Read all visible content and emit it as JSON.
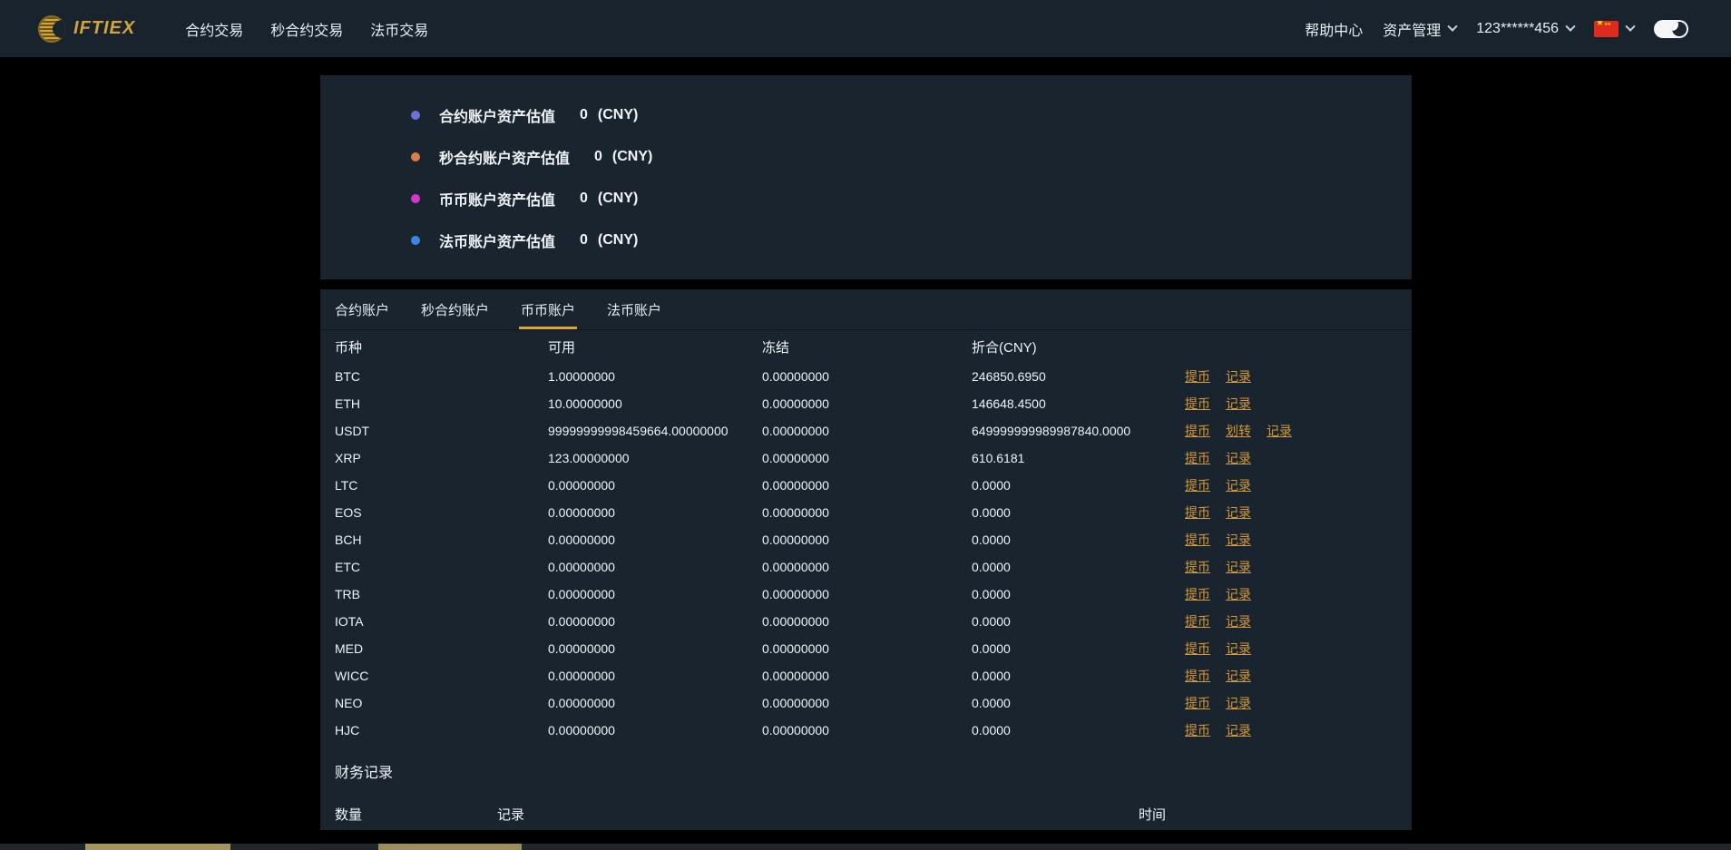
{
  "colors": {
    "page_bg": "#000000",
    "navbar_bg": "#19232d",
    "panel_bg": "#1a242f",
    "accent_gold_link": "#d29a39",
    "tab_underline": "#d9a740",
    "flag_red": "#de2b1e"
  },
  "navbar": {
    "logo_text": "IFTIEX",
    "items": [
      {
        "label": "合约交易"
      },
      {
        "label": "秒合约交易"
      },
      {
        "label": "法币交易"
      }
    ],
    "help": "帮助中心",
    "assets_menu": "资产管理",
    "account": "123******456"
  },
  "summary": {
    "rows": [
      {
        "label": "合约账户资产估值",
        "value": "0",
        "unit": "(CNY)",
        "color": "#7070dd"
      },
      {
        "label": "秒合约账户资产估值",
        "value": "0",
        "unit": "(CNY)",
        "color": "#e07b4a"
      },
      {
        "label": "币币账户资产估值",
        "value": "0",
        "unit": "(CNY)",
        "color": "#d238ce"
      },
      {
        "label": "法币账户资产估值",
        "value": "0",
        "unit": "(CNY)",
        "color": "#3a87e6"
      }
    ]
  },
  "tabs": [
    {
      "label": "合约账户",
      "active": false
    },
    {
      "label": "秒合约账户",
      "active": false
    },
    {
      "label": "币币账户",
      "active": true
    },
    {
      "label": "法币账户",
      "active": false
    }
  ],
  "wallet": {
    "headers": {
      "coin": "币种",
      "available": "可用",
      "frozen": "冻结",
      "cny": "折合(CNY)"
    },
    "action_labels": {
      "withdraw": "提币",
      "transfer": "划转",
      "record": "记录"
    },
    "rows": [
      {
        "coin": "BTC",
        "available": "1.00000000",
        "frozen": "0.00000000",
        "cny": "246850.6950"
      },
      {
        "coin": "ETH",
        "available": "10.00000000",
        "frozen": "0.00000000",
        "cny": "146648.4500"
      },
      {
        "coin": "USDT",
        "available": "99999999998459664.00000000",
        "frozen": "0.00000000",
        "cny": "649999999989987840.0000",
        "has_transfer": true
      },
      {
        "coin": "XRP",
        "available": "123.00000000",
        "frozen": "0.00000000",
        "cny": "610.6181"
      },
      {
        "coin": "LTC",
        "available": "0.00000000",
        "frozen": "0.00000000",
        "cny": "0.0000"
      },
      {
        "coin": "EOS",
        "available": "0.00000000",
        "frozen": "0.00000000",
        "cny": "0.0000"
      },
      {
        "coin": "BCH",
        "available": "0.00000000",
        "frozen": "0.00000000",
        "cny": "0.0000"
      },
      {
        "coin": "ETC",
        "available": "0.00000000",
        "frozen": "0.00000000",
        "cny": "0.0000"
      },
      {
        "coin": "TRB",
        "available": "0.00000000",
        "frozen": "0.00000000",
        "cny": "0.0000"
      },
      {
        "coin": "IOTA",
        "available": "0.00000000",
        "frozen": "0.00000000",
        "cny": "0.0000"
      },
      {
        "coin": "MED",
        "available": "0.00000000",
        "frozen": "0.00000000",
        "cny": "0.0000"
      },
      {
        "coin": "WICC",
        "available": "0.00000000",
        "frozen": "0.00000000",
        "cny": "0.0000"
      },
      {
        "coin": "NEO",
        "available": "0.00000000",
        "frozen": "0.00000000",
        "cny": "0.0000"
      },
      {
        "coin": "HJC",
        "available": "0.00000000",
        "frozen": "0.00000000",
        "cny": "0.0000"
      }
    ]
  },
  "records": {
    "title": "财务记录",
    "headers": {
      "amount": "数量",
      "record": "记录",
      "time": "时间"
    }
  }
}
